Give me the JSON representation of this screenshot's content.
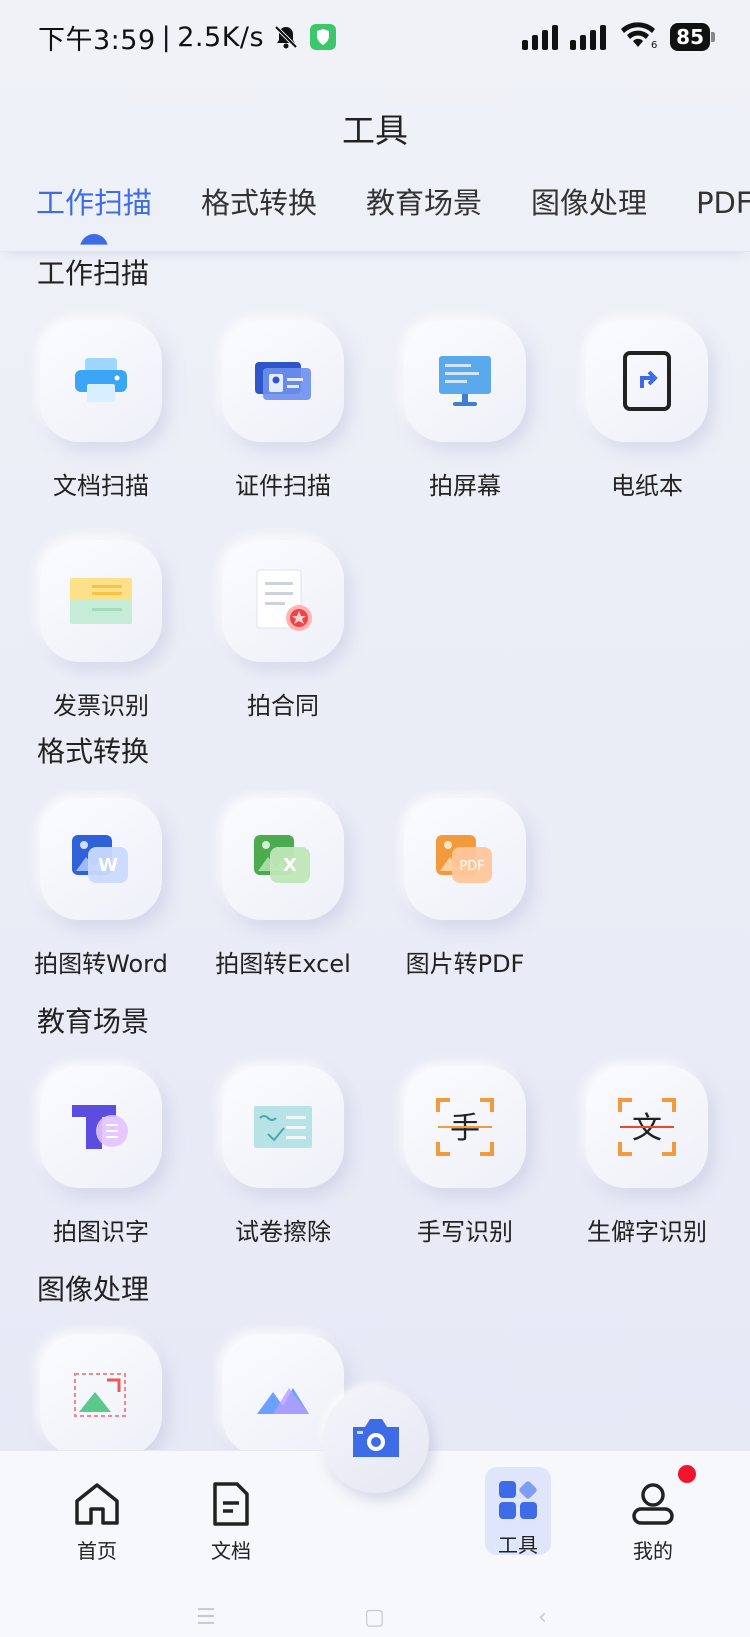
{
  "status_bar": {
    "time": "下午3:59",
    "separator": "|",
    "speed": "2.5K/s",
    "battery": "85",
    "icons": [
      "bell-muted-icon",
      "shield-icon",
      "signal-icon",
      "signal-icon",
      "wifi-icon"
    ]
  },
  "header": {
    "title": "工具"
  },
  "tabs": [
    {
      "label": "工作扫描",
      "active": true
    },
    {
      "label": "格式转换"
    },
    {
      "label": "教育场景"
    },
    {
      "label": "图像处理"
    },
    {
      "label": "PDF工"
    }
  ],
  "sections": {
    "work_scan": {
      "title": "工作扫描",
      "items": [
        {
          "label": "文档扫描",
          "icon": "printer-icon"
        },
        {
          "label": "证件扫描",
          "icon": "id-card-icon"
        },
        {
          "label": "拍屏幕",
          "icon": "monitor-icon"
        },
        {
          "label": "电纸本",
          "icon": "e-ink-tablet-icon"
        },
        {
          "label": "发票识别",
          "icon": "invoice-icon"
        },
        {
          "label": "拍合同",
          "icon": "contract-icon"
        }
      ]
    },
    "format_convert": {
      "title": "格式转换",
      "items": [
        {
          "label": "拍图转Word",
          "icon": "image-to-word-icon",
          "badge": "W"
        },
        {
          "label": "拍图转Excel",
          "icon": "image-to-excel-icon",
          "badge": "X"
        },
        {
          "label": "图片转PDF",
          "icon": "image-to-pdf-icon",
          "badge": "PDF"
        }
      ]
    },
    "education": {
      "title": "教育场景",
      "items": [
        {
          "label": "拍图识字",
          "icon": "text-recognition-icon"
        },
        {
          "label": "试卷擦除",
          "icon": "exam-erase-icon"
        },
        {
          "label": "手写识别",
          "icon": "handwriting-icon",
          "glyph": "手"
        },
        {
          "label": "生僻字识别",
          "icon": "rare-char-icon",
          "glyph": "文"
        }
      ]
    },
    "image_processing": {
      "title": "图像处理",
      "items": [
        {
          "label": "",
          "icon": "image-resize-icon"
        },
        {
          "label": "",
          "icon": "mountain-image-icon"
        }
      ]
    }
  },
  "bottom_nav": {
    "items": [
      {
        "label": "首页",
        "icon": "home-icon"
      },
      {
        "label": "文档",
        "icon": "document-icon"
      },
      {
        "label": "工具",
        "icon": "tools-grid-icon",
        "active": true
      },
      {
        "label": "我的",
        "icon": "user-icon"
      }
    ],
    "camera": {
      "icon": "camera-icon"
    },
    "colors": {
      "accent": "#3e6ce6",
      "badge": "#f0142f"
    }
  }
}
